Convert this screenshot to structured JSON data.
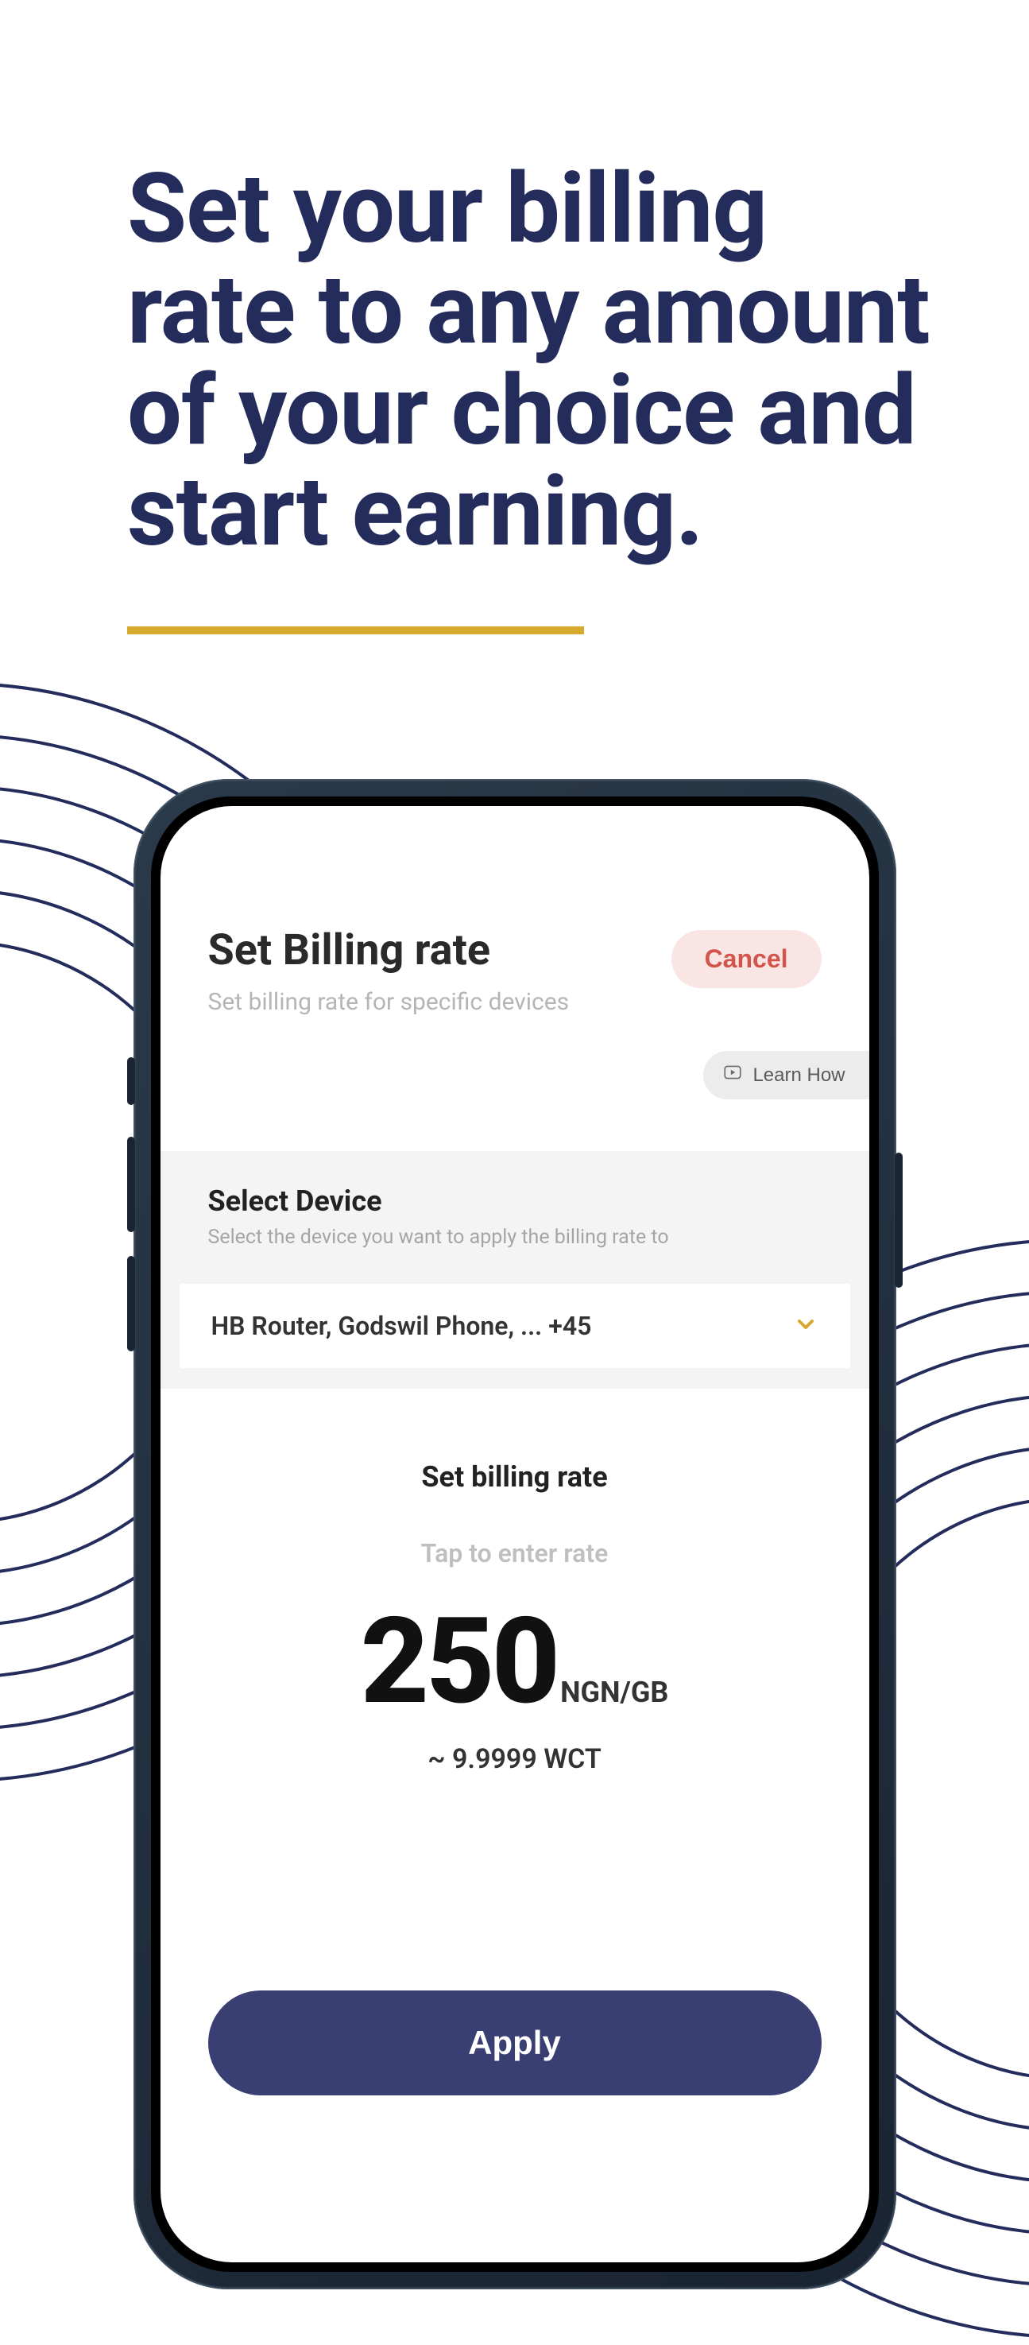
{
  "colors": {
    "primary": "#242c5c",
    "accent": "#d7a92e",
    "cancel_bg": "#f9e6e4",
    "cancel_fg": "#d2544b",
    "apply_bg": "#3a3f73"
  },
  "headline": "Set your billing rate to any amount of your choice and start earning.",
  "screen": {
    "title": "Set Billing rate",
    "subtitle": "Set billing rate for specific devices",
    "cancel": "Cancel",
    "learn_how": "Learn How",
    "select": {
      "title": "Select Device",
      "subtitle": "Select the device you want to apply the billing rate to",
      "value": "HB Router, Godswil Phone, ... +45"
    },
    "rate": {
      "title": "Set billing rate",
      "hint": "Tap to enter rate",
      "value": "250",
      "unit": "NGN/GB",
      "approx": "~ 9.9999 WCT"
    },
    "apply": "Apply"
  }
}
